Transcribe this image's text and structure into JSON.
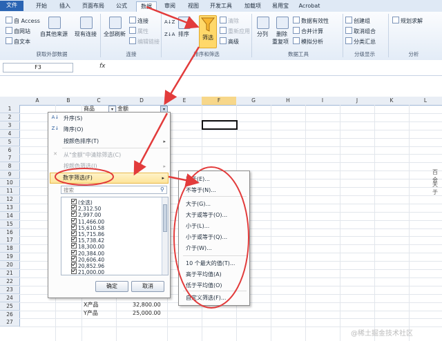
{
  "tabs": [
    "文件",
    "开始",
    "插入",
    "页面布局",
    "公式",
    "数据",
    "审阅",
    "视图",
    "开发工具",
    "加载项",
    "易用宝",
    "Acrobat"
  ],
  "ribbon": {
    "external_data": {
      "access": "自 Access",
      "web": "自网站",
      "text": "自文本",
      "other": "自其他来源",
      "existing": "现有连接",
      "title": "获取外部数据"
    },
    "connections": {
      "refresh_all": "全部刷新",
      "connections": "连接",
      "properties": "属性",
      "edit_links": "编辑链接",
      "title": "连接"
    },
    "sort_filter": {
      "sort": "排序",
      "filter": "筛选",
      "clear": "清除",
      "reapply": "重新应用",
      "advanced": "高级",
      "title": "排序和筛选"
    },
    "data_tools": {
      "text_to_columns": "分列",
      "remove_duplicates": "删除",
      "remove_duplicates_2": "重复项",
      "data_validation": "数据有效性",
      "consolidate": "合并计算",
      "what_if": "模拟分析",
      "title": "数据工具"
    },
    "outline": {
      "group": "创建组",
      "ungroup": "取消组合",
      "subtotal": "分类汇总",
      "title": "分级显示"
    },
    "analysis": {
      "solver": "规划求解",
      "title": "分析"
    }
  },
  "formula_bar": {
    "name_box": "F3",
    "fx": "fx",
    "value": ""
  },
  "columns": [
    "A",
    "B",
    "C",
    "D",
    "E",
    "F",
    "G",
    "H",
    "I",
    "J",
    "K",
    "L"
  ],
  "rows": [
    "1",
    "2",
    "3",
    "4",
    "5",
    "6",
    "7",
    "8",
    "9",
    "10",
    "11",
    "12",
    "13",
    "14",
    "15",
    "16",
    "17",
    "18",
    "19",
    "20",
    "21",
    "22",
    "23",
    "24",
    "25",
    "26",
    "27"
  ],
  "cells": {
    "c1": "商品",
    "d1": "金额",
    "c25": "X产品",
    "d25": "32,800.00",
    "c26": "Y产品",
    "d26": "25,000.00"
  },
  "filter_menu": {
    "sort_asc": "升序(S)",
    "sort_desc": "降序(O)",
    "sort_color": "按颜色排序(T)",
    "clear_filter": "从\"金额\"中清除筛选(C)",
    "color_filter": "按颜色筛选(I)",
    "number_filter": "数字筛选(F)",
    "search_placeholder": "搜索",
    "list": [
      "(全选)",
      "2,312.50",
      "2,997.00",
      "11,466.00",
      "15,610.58",
      "15,715.86",
      "15,738.42",
      "18,300.00",
      "20,384.00",
      "20,606.40",
      "20,852.96",
      "21,000.00"
    ],
    "ok": "确定",
    "cancel": "取消"
  },
  "number_filter_submenu": [
    "等于(E)...",
    "不等于(N)...",
    "大于(G)...",
    "大于或等于(O)...",
    "小于(L)...",
    "小于或等于(Q)...",
    "介于(W)...",
    "10 个最大的值(T)...",
    "高于平均值(A)",
    "低于平均值(O)",
    "自定义筛选(F)..."
  ],
  "right_edge_text": [
    "百会",
    "天于"
  ],
  "watermark": "@稀土掘金技术社区",
  "colors": {
    "accent": "#2a64b3",
    "annotation": "#e23b3b",
    "highlight": "#fde49a"
  }
}
